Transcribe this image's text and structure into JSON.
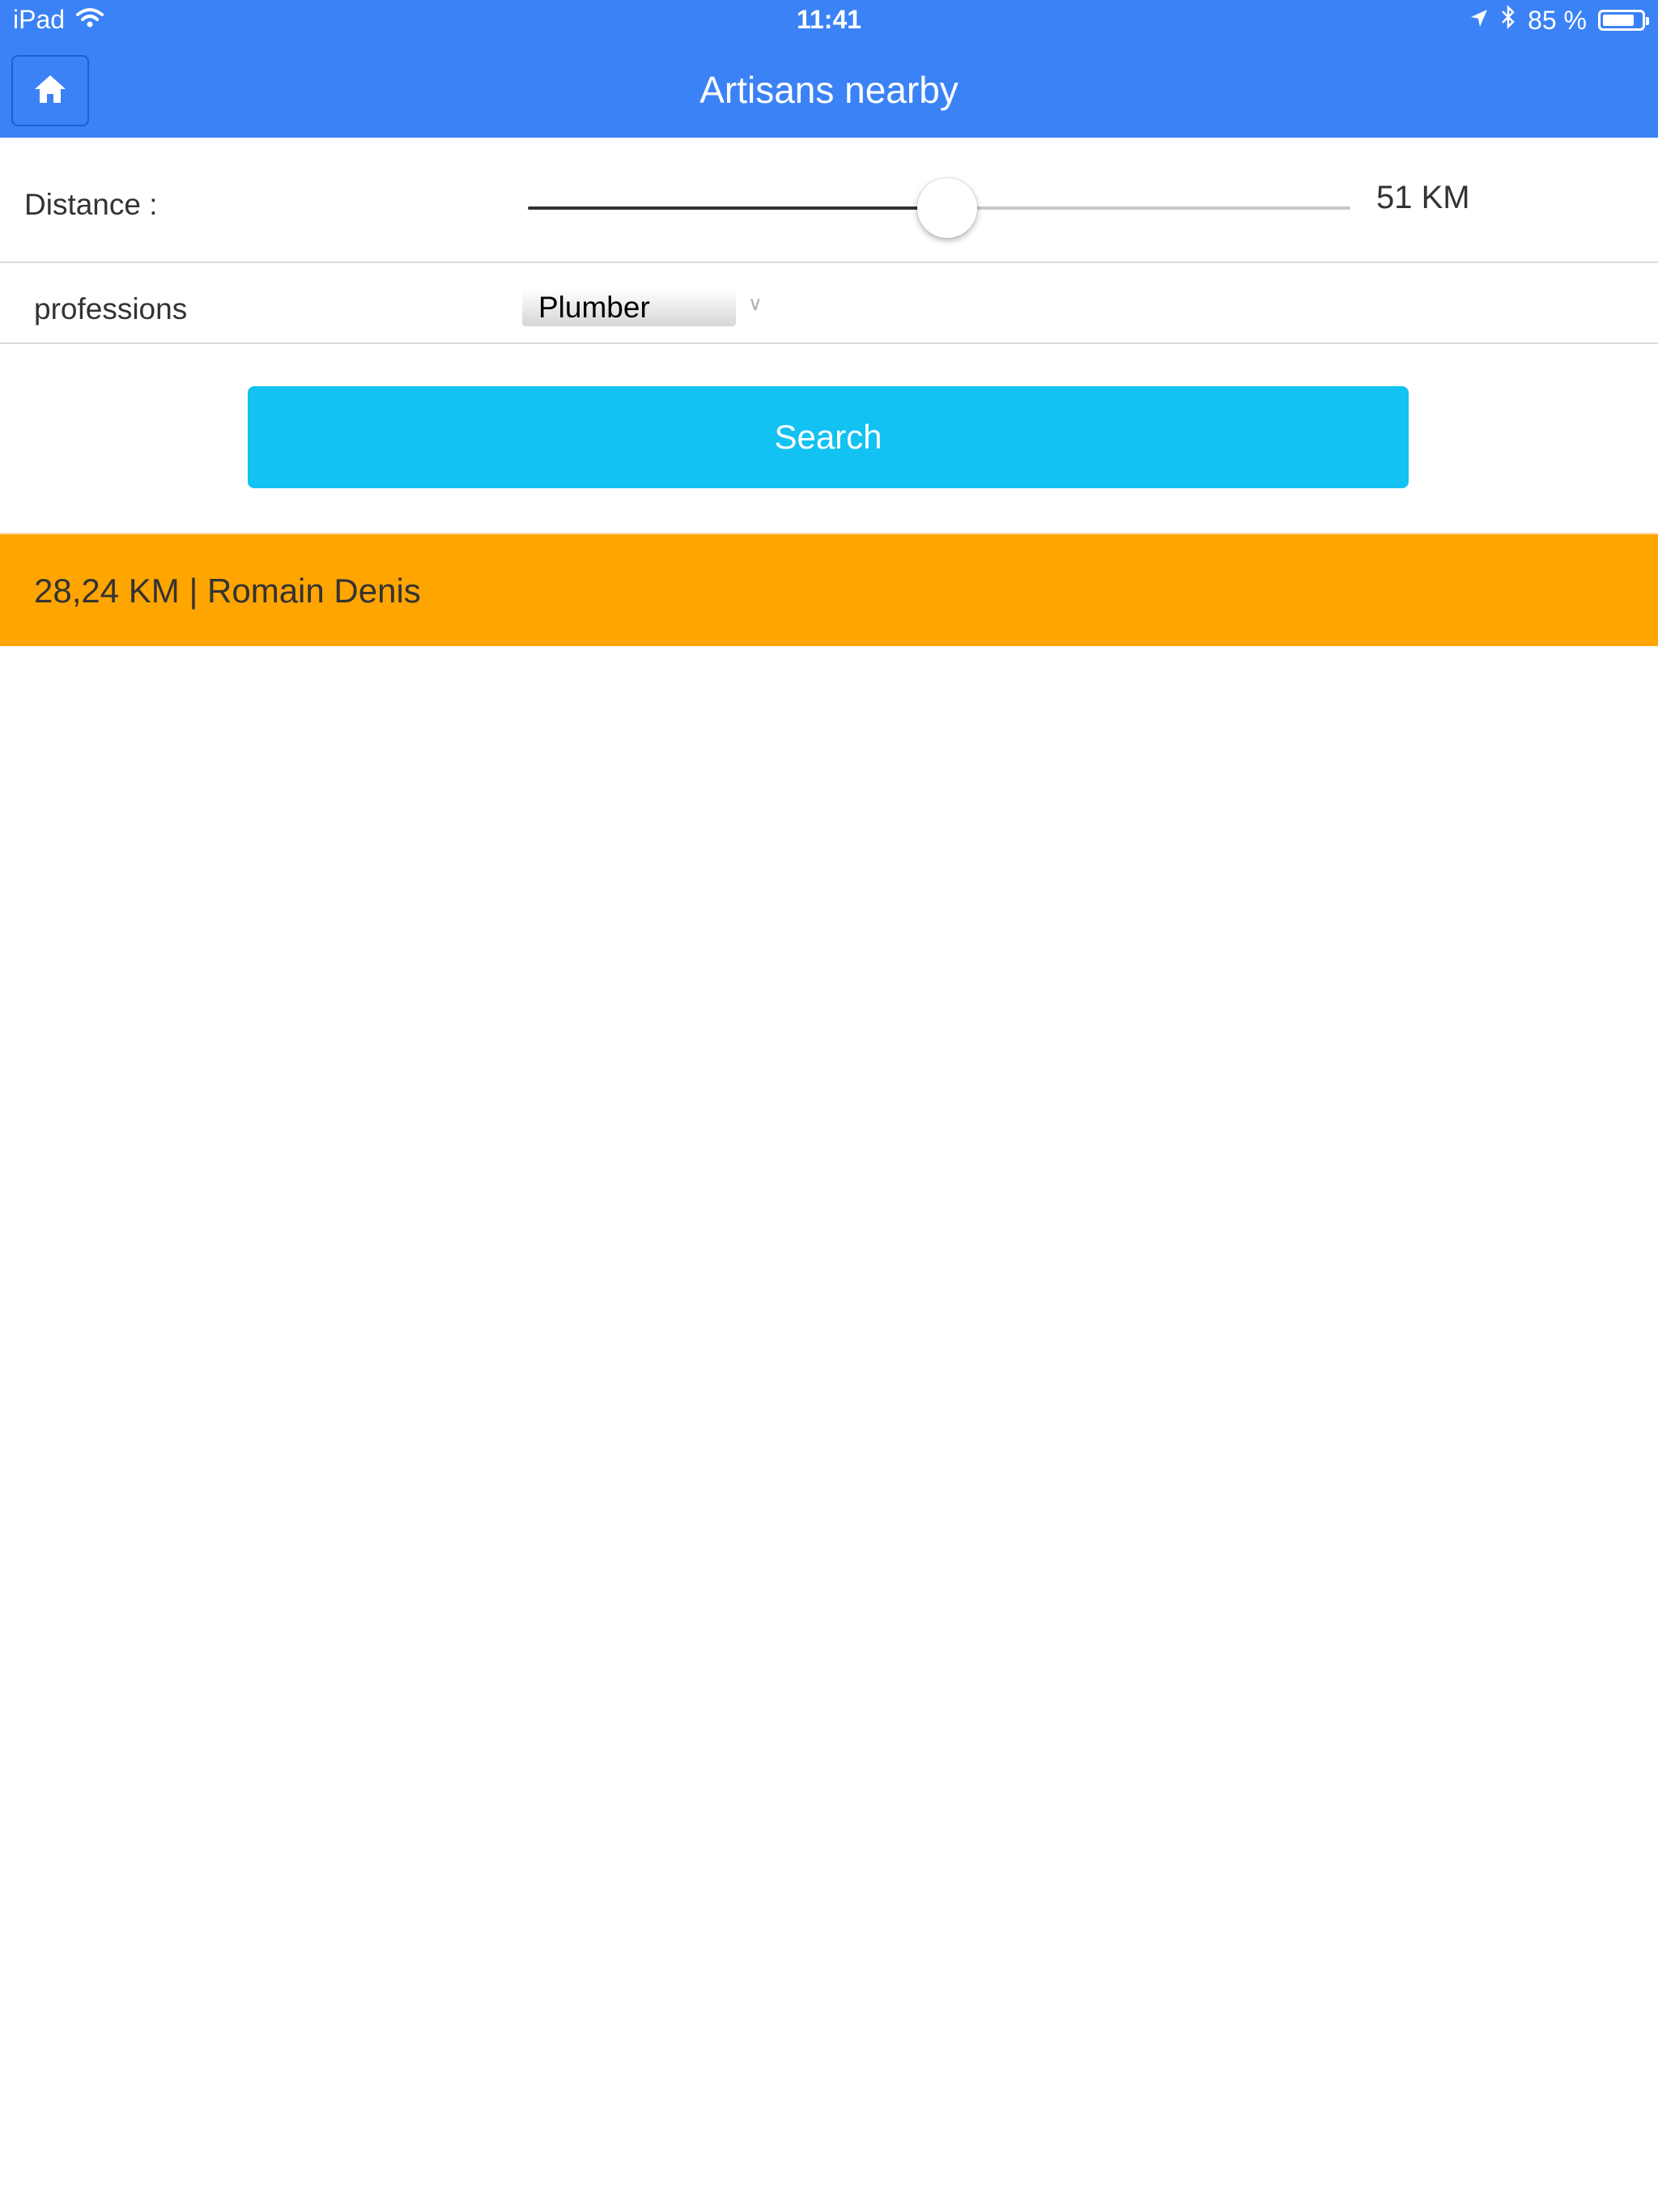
{
  "status_bar": {
    "device": "iPad",
    "time": "11:41",
    "battery_percent": "85 %",
    "battery_level": 0.85
  },
  "nav": {
    "title": "Artisans nearby",
    "home_icon": "home-icon"
  },
  "filters": {
    "distance_label": "Distance :",
    "distance_value_label": "51 KM",
    "distance_slider_fraction": 0.51,
    "profession_label": "professions",
    "profession_selected": "Plumber"
  },
  "search": {
    "label": "Search"
  },
  "results": [
    {
      "label": "28,24 KM | Romain Denis"
    }
  ],
  "colors": {
    "nav": "#3b82f6",
    "search_button": "#12c2f2",
    "result_highlight": "#ffa500"
  }
}
